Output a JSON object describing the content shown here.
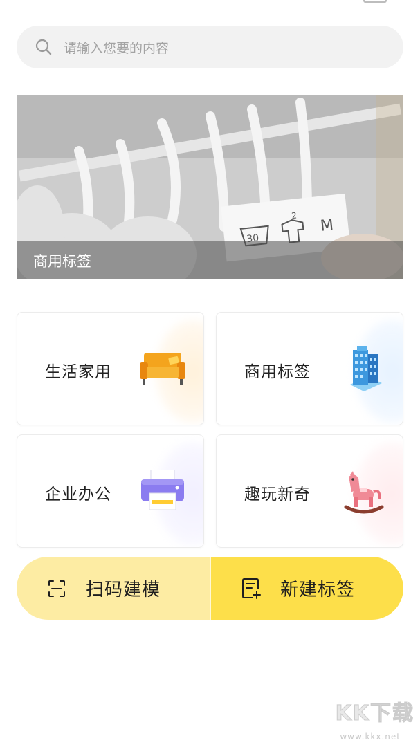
{
  "search": {
    "placeholder": "请输入您要的内容",
    "icon": "search-icon"
  },
  "banner": {
    "caption": "商用标签",
    "tag_texts": [
      "30",
      "2",
      "M"
    ]
  },
  "categories": [
    {
      "label": "生活家用",
      "icon": "sofa-icon",
      "accent": "#f7a21b"
    },
    {
      "label": "商用标签",
      "icon": "building-icon",
      "accent": "#4aa8e8"
    },
    {
      "label": "企业办公",
      "icon": "printer-icon",
      "accent": "#8b7cf0"
    },
    {
      "label": "趣玩新奇",
      "icon": "rocking-horse-icon",
      "accent": "#f08a96"
    }
  ],
  "actions": {
    "scan": {
      "label": "扫码建模",
      "icon": "scan-icon",
      "color": "#fdeca3"
    },
    "new": {
      "label": "新建标签",
      "icon": "new-label-icon",
      "color": "#fddf4a"
    }
  },
  "watermark": {
    "text": "KK下载",
    "url": "www.kkx.net"
  }
}
